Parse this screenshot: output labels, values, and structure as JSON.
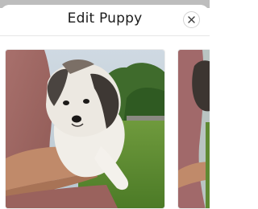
{
  "modal": {
    "title": "Edit Puppy",
    "close_icon": "close-icon"
  },
  "gallery": {
    "photos": [
      {
        "subject": "puppy-photo",
        "state": "current"
      },
      {
        "subject": "puppy-photo",
        "state": "next"
      }
    ]
  },
  "colors": {
    "title_text": "#1b1b1b",
    "header_border": "#e6e6e6",
    "close_border": "#d2d2d2",
    "backdrop": "#bdbdbd"
  }
}
